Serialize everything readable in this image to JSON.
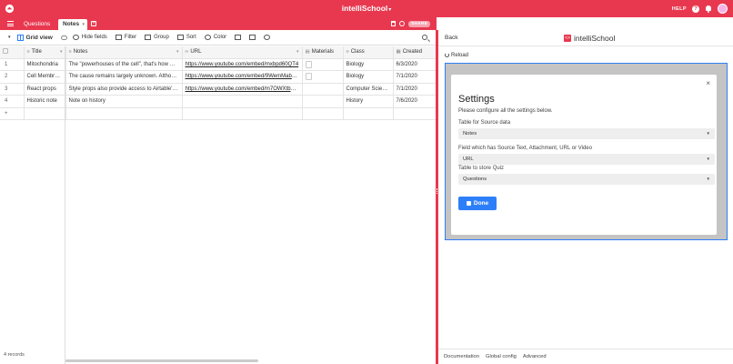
{
  "app": {
    "title": "intelliSchool"
  },
  "topbar": {
    "help": "HELP",
    "help_icon": "?"
  },
  "tabs": {
    "questions": "Questions",
    "notes": "Notes",
    "add": "+"
  },
  "header_tools": {
    "share": "SHARE",
    "blocks": "BLOCKS"
  },
  "toolbar": {
    "view": "Grid view",
    "hide_fields": "Hide fields",
    "filter": "Filter",
    "group": "Group",
    "sort": "Sort",
    "color": "Color"
  },
  "grid": {
    "columns": [
      "Title",
      "Notes",
      "URL",
      "Materials",
      "Class",
      "Created"
    ],
    "rows": [
      {
        "num": "1",
        "title": "Mitochondria",
        "notes": "The \"powerhouses of the cell\", that's how man...",
        "url": "https://www.youtube.com/embed/mxbpd60QT4",
        "materials": true,
        "class": "Biology",
        "created": "6/3/2020"
      },
      {
        "num": "2",
        "title": "Cell Membrane",
        "notes": "The cause remains largely unknown. Although...",
        "url": "https://www.youtube.com/embed/9WemMabX_U",
        "materials": true,
        "class": "Biology",
        "created": "7/1/2020"
      },
      {
        "num": "3",
        "title": "React props",
        "notes": "Style props also provide access to Airtable's d...",
        "url": "https://www.youtube.com/embed/m7OWXtbXX8",
        "materials": false,
        "class": "Computer Science",
        "created": "7/1/2020"
      },
      {
        "num": "4",
        "title": "Historic note",
        "notes": "Note on history",
        "url": "",
        "materials": false,
        "class": "History",
        "created": "7/6/2020"
      }
    ],
    "add_row": "+",
    "record_count": "4 records"
  },
  "block": {
    "back": "Back",
    "title": "intelliSchool",
    "reload": "Reload"
  },
  "settings": {
    "title": "Settings",
    "description": "Please configure all the settings below.",
    "close": "×",
    "table_label": "Table for Source data",
    "table_value": "Notes",
    "field_label": "Field which has Source Text, Attachment, URL or Video",
    "field_value": "URL",
    "quiz_label": "Table to store Quiz",
    "quiz_value": "Questions",
    "done": "Done"
  },
  "footer": {
    "documentation": "Documentation",
    "global_config": "Global config",
    "advanced": "Advanced"
  },
  "colors": {
    "brand": "#e8384f",
    "accent": "#2d7ff9",
    "frame_bg": "#c4c4c4"
  }
}
